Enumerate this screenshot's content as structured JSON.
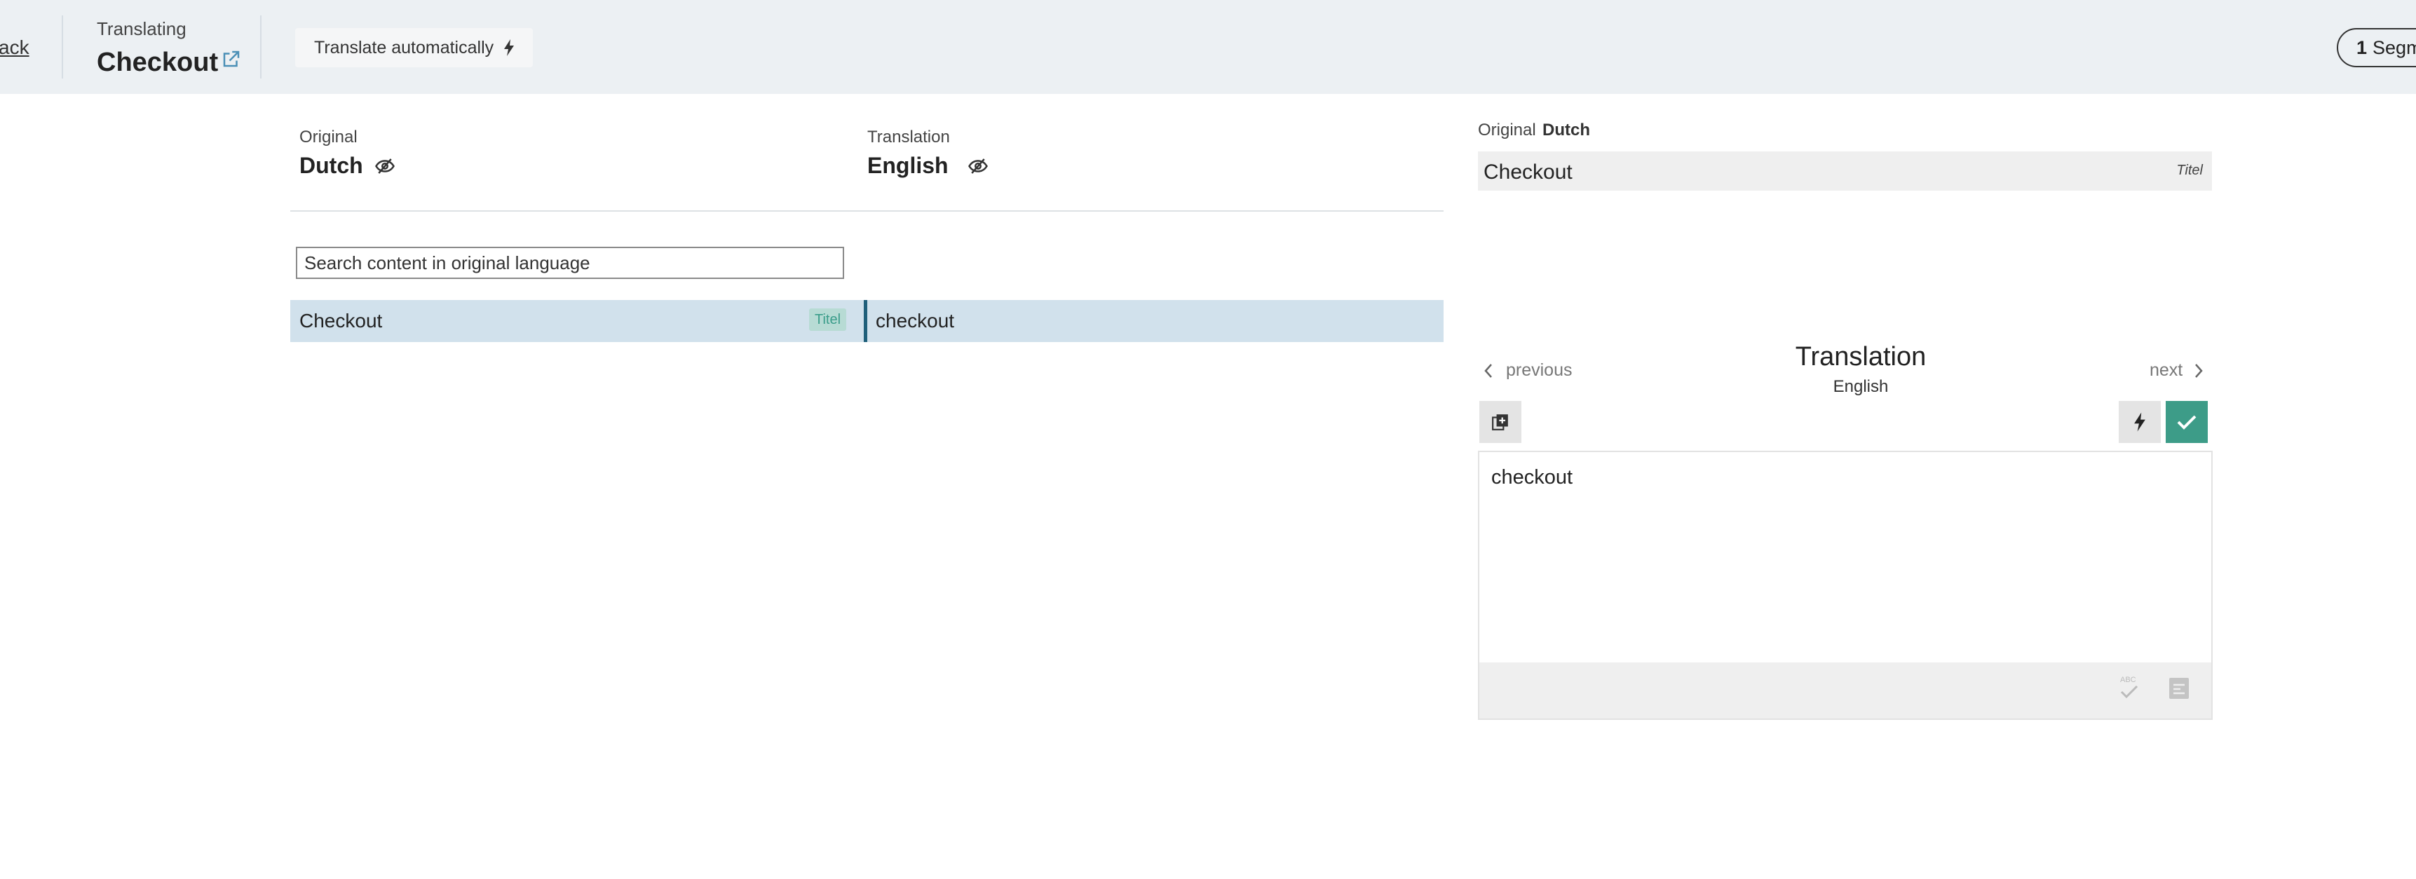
{
  "header": {
    "back_label": "ack",
    "subtitle": "Translating",
    "title": "Checkout",
    "auto_translate_label": "Translate automatically",
    "segments_count": "1",
    "segments_label": "Segm"
  },
  "languages": {
    "original_label": "Original",
    "original_name": "Dutch",
    "translation_label": "Translation",
    "translation_name": "English"
  },
  "search": {
    "placeholder": "Search content in original language"
  },
  "segments": [
    {
      "original": "Checkout",
      "tag": "Titel",
      "translation": "checkout"
    }
  ],
  "panel": {
    "original_label": "Original",
    "original_lang": "Dutch",
    "original_text": "Checkout",
    "original_tag": "Titel",
    "previous_label": "previous",
    "next_label": "next",
    "translation_title": "Translation",
    "translation_lang": "English",
    "editor_text": "checkout"
  },
  "icons": {
    "external": "external-link-icon",
    "bolt": "lightning-bolt-icon",
    "eye": "eye-slash-icon",
    "copy": "copy-original-icon",
    "check": "check-icon",
    "spellcheck": "spellcheck-icon",
    "special": "special-characters-icon"
  },
  "colors": {
    "header_bg": "#ecf0f3",
    "row_highlight": "#d1e1ec",
    "accent_green": "#3d9c88",
    "tag_bg": "#b7dbd4",
    "row_bar": "#1f5f7a"
  }
}
